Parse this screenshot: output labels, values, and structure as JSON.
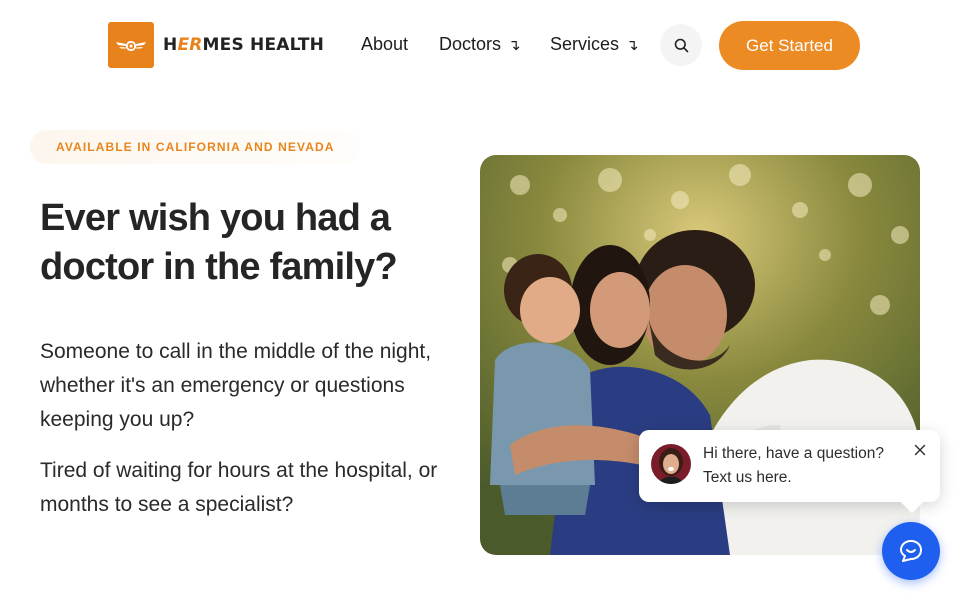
{
  "brand": {
    "name_parts": [
      "H",
      "ER",
      "MES HEALTH"
    ],
    "accent_color": "#e8821c"
  },
  "nav": {
    "items": [
      {
        "label": "About"
      },
      {
        "label": "Doctors",
        "arrow": "↴"
      },
      {
        "label": "Services",
        "arrow": "↴"
      }
    ],
    "cta_label": "Get Started",
    "cta_color": "#ec8a24",
    "search_icon": "search-icon"
  },
  "hero": {
    "eyebrow": "AVAILABLE IN CALIFORNIA AND NEVADA",
    "headline": "Ever wish you had a doctor in the family?",
    "paragraphs": [
      "Someone to call in the middle of the night, whether it's an emergency or questions keeping you up?",
      "Tired of waiting for hours at the hospital, or months to see a specialist?"
    ]
  },
  "chat": {
    "message_line1": "Hi there, have a question?",
    "message_line2": "Text us here.",
    "fab_color": "#1f5ff0",
    "close_icon": "close-icon",
    "fab_icon": "chat-bubble-icon"
  }
}
